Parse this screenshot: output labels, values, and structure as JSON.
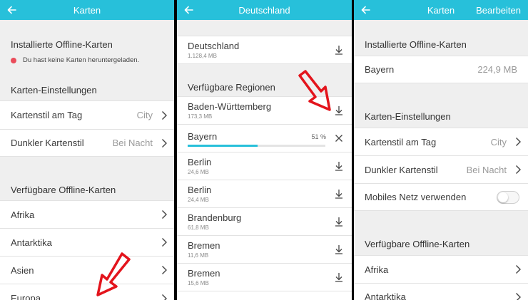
{
  "panel1": {
    "title": "Karten",
    "installed_header": "Installierte Offline-Karten",
    "no_maps_note": "Du hast keine Karten heruntergeladen.",
    "settings_header": "Karten-Einstellungen",
    "settings": [
      {
        "label": "Kartenstil am Tag",
        "value": "City"
      },
      {
        "label": "Dunkler Kartenstil",
        "value": "Bei Nacht"
      }
    ],
    "available_header": "Verfügbare Offline-Karten",
    "regions": [
      {
        "label": "Afrika"
      },
      {
        "label": "Antarktika"
      },
      {
        "label": "Asien"
      },
      {
        "label": "Europa"
      }
    ]
  },
  "panel2": {
    "title": "Deutschland",
    "country": {
      "label": "Deutschland",
      "size": "1.128,4 MB"
    },
    "regions_header": "Verfügbare Regionen",
    "bw": {
      "label": "Baden-Württemberg",
      "size": "173,3 MB"
    },
    "downloading": {
      "label": "Bayern",
      "percent": "51 %",
      "progress": 0.51
    },
    "regions": [
      {
        "label": "Berlin",
        "size": "24,6 MB"
      },
      {
        "label": "Berlin",
        "size": "24,4 MB"
      },
      {
        "label": "Brandenburg",
        "size": "61,8 MB"
      },
      {
        "label": "Bremen",
        "size": "11,6 MB"
      },
      {
        "label": "Bremen",
        "size": "15,6 MB"
      }
    ]
  },
  "panel3": {
    "title": "Karten",
    "edit_label": "Bearbeiten",
    "installed_header": "Installierte Offline-Karten",
    "installed": {
      "label": "Bayern",
      "size": "224,9 MB"
    },
    "settings_header": "Karten-Einstellungen",
    "settings": [
      {
        "label": "Kartenstil am Tag",
        "value": "City"
      },
      {
        "label": "Dunkler Kartenstil",
        "value": "Bei Nacht"
      }
    ],
    "mobile_label": "Mobiles Netz verwenden",
    "available_header": "Verfügbare Offline-Karten",
    "regions": [
      {
        "label": "Afrika"
      },
      {
        "label": "Antarktika"
      }
    ]
  },
  "colors": {
    "accent": "#27c0da",
    "alert": "#ea4c5a",
    "arrow": "#e3141c"
  }
}
